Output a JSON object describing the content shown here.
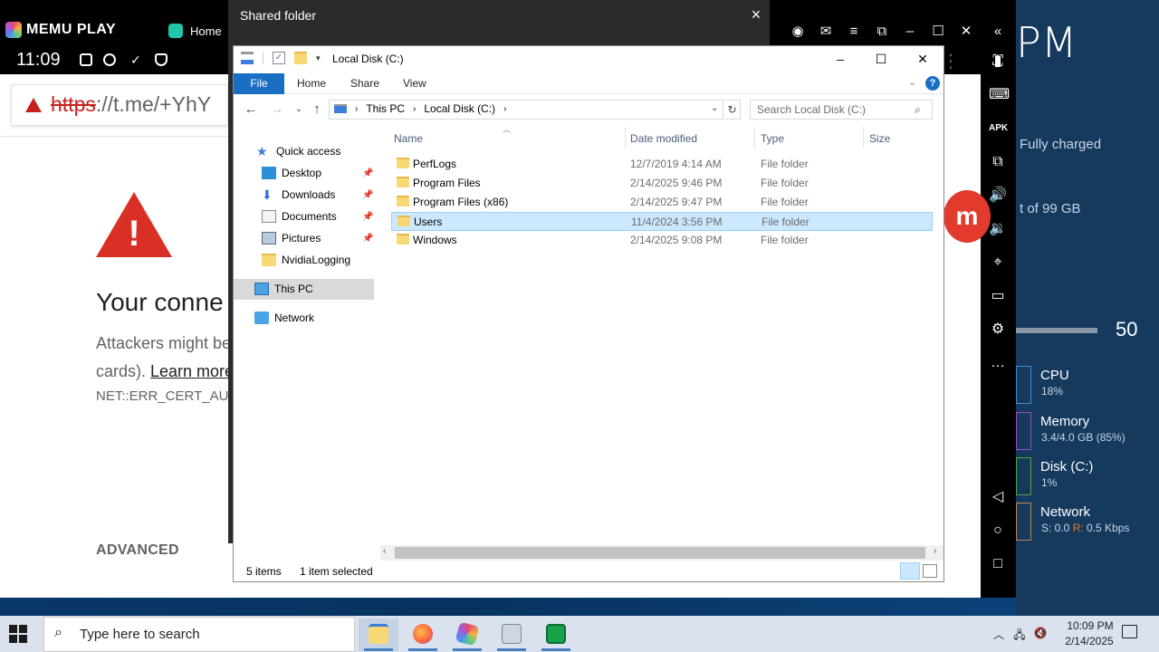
{
  "memu": {
    "logo": "MEMU PLAY",
    "tab_label": "Home",
    "status_time": "11:09"
  },
  "browser": {
    "url_scheme": "https",
    "url_rest": "://t.me/+YhY",
    "error_title": "Your conne",
    "body_line1": "Attackers might be",
    "body_line2_prefix": "cards). ",
    "body_line2_link": "Learn more",
    "error_code": "NET::ERR_CERT_AU",
    "advanced_label": "ADVANCED"
  },
  "shared_folder": {
    "title": "Shared folder",
    "close_icon": "×"
  },
  "explorer": {
    "title": "Local Disk (C:)",
    "ribbon_tabs": [
      "File",
      "Home",
      "Share",
      "View"
    ],
    "address_parts": [
      "This PC",
      "Local Disk (C:)"
    ],
    "search_placeholder": "Search Local Disk (C:)",
    "nav_pane": {
      "quick_access": "Quick access",
      "desktop": "Desktop",
      "downloads": "Downloads",
      "documents": "Documents",
      "pictures": "Pictures",
      "nvidia": "NvidiaLogging",
      "this_pc": "This PC",
      "network": "Network"
    },
    "columns": [
      "Name",
      "Date modified",
      "Type",
      "Size"
    ],
    "rows": [
      {
        "name": "PerfLogs",
        "date": "12/7/2019 4:14 AM",
        "type": "File folder"
      },
      {
        "name": "Program Files",
        "date": "2/14/2025 9:46 PM",
        "type": "File folder"
      },
      {
        "name": "Program Files (x86)",
        "date": "2/14/2025 9:47 PM",
        "type": "File folder"
      },
      {
        "name": "Users",
        "date": "11/4/2024 3:56 PM",
        "type": "File folder"
      },
      {
        "name": "Windows",
        "date": "2/14/2025 9:08 PM",
        "type": "File folder"
      }
    ],
    "selected_index": 3,
    "status_items": "5 items",
    "status_selected": "1 item selected"
  },
  "side_panel": {
    "clock": "PM",
    "battery": "Fully charged",
    "storage": "t of 99 GB",
    "brightness_value": "50",
    "perf": [
      {
        "title": "CPU",
        "sub": "18%",
        "color": "#3d8fd6"
      },
      {
        "title": "Memory",
        "sub": "3.4/4.0 GB (85%)",
        "color": "#9b4fc2"
      },
      {
        "title": "Disk (C:)",
        "sub": "1%",
        "color": "#4caa3f"
      },
      {
        "title": "Network",
        "sub_prefix": "S: 0.0 ",
        "sub_r": "R:",
        "sub_suffix": " 0.5 Kbps",
        "color": "#c4864a"
      }
    ]
  },
  "taskbar": {
    "search_placeholder": "Type here to search",
    "time": "10:09 PM",
    "date": "2/14/2025"
  }
}
